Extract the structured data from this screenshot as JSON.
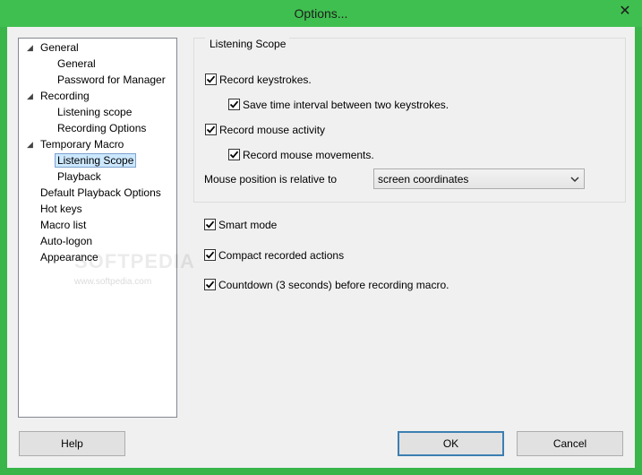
{
  "window": {
    "title": "Options...",
    "close_glyph": "✕",
    "accent_color": "#39b54a"
  },
  "tree": {
    "items": [
      {
        "label": "General",
        "expandable": true,
        "expanded": true
      },
      {
        "label": "General"
      },
      {
        "label": "Password for Manager"
      },
      {
        "label": "Recording",
        "expandable": true,
        "expanded": true
      },
      {
        "label": "Listening scope"
      },
      {
        "label": "Recording Options"
      },
      {
        "label": "Temporary Macro",
        "expandable": true,
        "expanded": true
      },
      {
        "label": "Listening Scope",
        "selected": true
      },
      {
        "label": "Playback"
      },
      {
        "label": "Default Playback Options"
      },
      {
        "label": "Hot keys"
      },
      {
        "label": "Macro list"
      },
      {
        "label": "Auto-logon"
      },
      {
        "label": "Appearance"
      }
    ]
  },
  "watermark": {
    "text": "SOFTPEDIA",
    "subtext": "www.softpedia.com"
  },
  "listening_scope": {
    "title": "Listening Scope",
    "record_keystrokes": {
      "label": "Record keystrokes.",
      "checked": true
    },
    "save_time_interval": {
      "label": "Save time interval between two keystrokes.",
      "checked": true
    },
    "record_mouse_activity": {
      "label": "Record mouse activity",
      "checked": true
    },
    "record_mouse_movements": {
      "label": "Record mouse movements.",
      "checked": true
    },
    "mouse_position_label": "Mouse position is relative to",
    "mouse_position_value": "screen coordinates"
  },
  "options": {
    "smart_mode": {
      "label": "Smart mode",
      "checked": true
    },
    "compact_actions": {
      "label": "Compact recorded actions",
      "checked": true
    },
    "countdown": {
      "label": "Countdown (3 seconds) before recording macro.",
      "checked": true
    }
  },
  "buttons": {
    "help": "Help",
    "ok": "OK",
    "cancel": "Cancel"
  }
}
